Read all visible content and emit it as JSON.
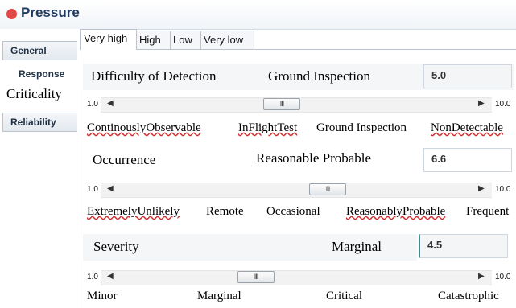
{
  "header": {
    "title": "Pressure",
    "status_color": "#e24848"
  },
  "sidebar": {
    "items": [
      {
        "label": "General"
      },
      {
        "label": "Response"
      },
      {
        "label": "Criticality"
      },
      {
        "label": "Reliability"
      }
    ]
  },
  "tabs": [
    {
      "label": "Very high"
    },
    {
      "label": "High"
    },
    {
      "label": "Low"
    },
    {
      "label": "Very low"
    }
  ],
  "detection": {
    "label": "Difficulty of Detection",
    "selected": "Ground Inspection",
    "value": "5.0",
    "scale_min": "1.0",
    "scale_max": "10.0",
    "thumb_glyph": "III",
    "options": [
      "ContinouslyObservable",
      "InFlightTest",
      "Ground Inspection",
      "NonDetectable"
    ]
  },
  "occurrence": {
    "label": "Occurrence",
    "selected": "Reasonable Probable",
    "value": "6.6",
    "scale_min": "1.0",
    "scale_max": "10.0",
    "thumb_glyph": "III",
    "options": [
      "ExtremelyUnlikely",
      "Remote",
      "Occasional",
      "ReasonablyProbable",
      "Frequent"
    ]
  },
  "severity": {
    "label": "Severity",
    "selected": "Marginal",
    "value": "4.5",
    "scale_min": "1.0",
    "scale_max": "10.0",
    "thumb_glyph": "III",
    "options": [
      "Minor",
      "Marginal",
      "Critical",
      "Catastrophic"
    ]
  },
  "icons": {
    "left_arrow": "◀",
    "right_arrow": "▶"
  }
}
